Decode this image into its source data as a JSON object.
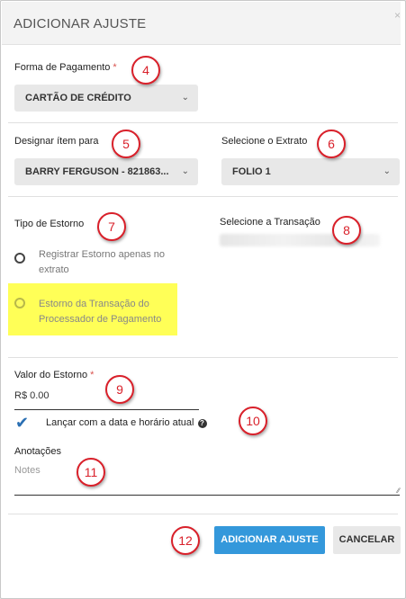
{
  "dialog": {
    "title": "ADICIONAR AJUSTE",
    "close": "×"
  },
  "payment": {
    "label": "Forma de Pagamento",
    "required": "*",
    "value": "CARTÃO DE CRÉDITO"
  },
  "designate": {
    "label": "Designar ítem para",
    "value": "BARRY FERGUSON - 821863..."
  },
  "statement": {
    "label": "Selecione o Extrato",
    "value": "FOLIO 1"
  },
  "refund_type": {
    "label": "Tipo de Estorno",
    "options": [
      {
        "line1": "Registrar Estorno apenas no",
        "line2": "extrato"
      },
      {
        "line1": "Estorno da Transação do",
        "line2": "Processador de Pagamento"
      }
    ]
  },
  "transaction": {
    "label": "Selecione a Transação"
  },
  "refund_value": {
    "label": "Valor do Estorno",
    "required": "*",
    "value": "R$  0.00"
  },
  "post_current": {
    "label": "Lançar com a data e horário atual",
    "help": "?"
  },
  "notes": {
    "label": "Anotações",
    "placeholder": "Notes"
  },
  "buttons": {
    "add": "ADICIONAR AJUSTE",
    "cancel": "CANCELAR"
  },
  "callouts": [
    "4",
    "5",
    "6",
    "7",
    "8",
    "9",
    "10",
    "11",
    "12"
  ],
  "colors": {
    "accent": "#3498db",
    "callout": "#d9202a",
    "highlight": "#ffff57",
    "check": "#2a6fb3"
  }
}
